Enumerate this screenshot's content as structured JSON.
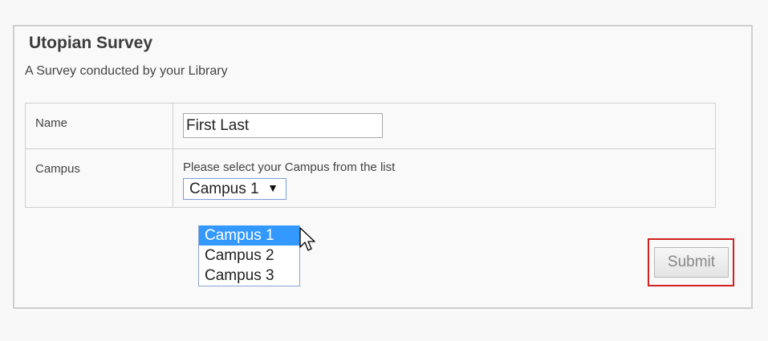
{
  "survey": {
    "title": "Utopian Survey",
    "subtitle": "A Survey conducted by your Library"
  },
  "fields": {
    "name": {
      "label": "Name",
      "value": "First Last"
    },
    "campus": {
      "label": "Campus",
      "hint": "Please select your Campus from the list",
      "selected": "Campus 1",
      "options": [
        "Campus 1",
        "Campus 2",
        "Campus 3"
      ]
    }
  },
  "actions": {
    "submit_label": "Submit"
  },
  "icons": {
    "dropdown_arrow": "▼",
    "cursor": "mouse-pointer-icon"
  },
  "colors": {
    "highlight": "#3399ff",
    "annotation_box": "#d02020"
  }
}
